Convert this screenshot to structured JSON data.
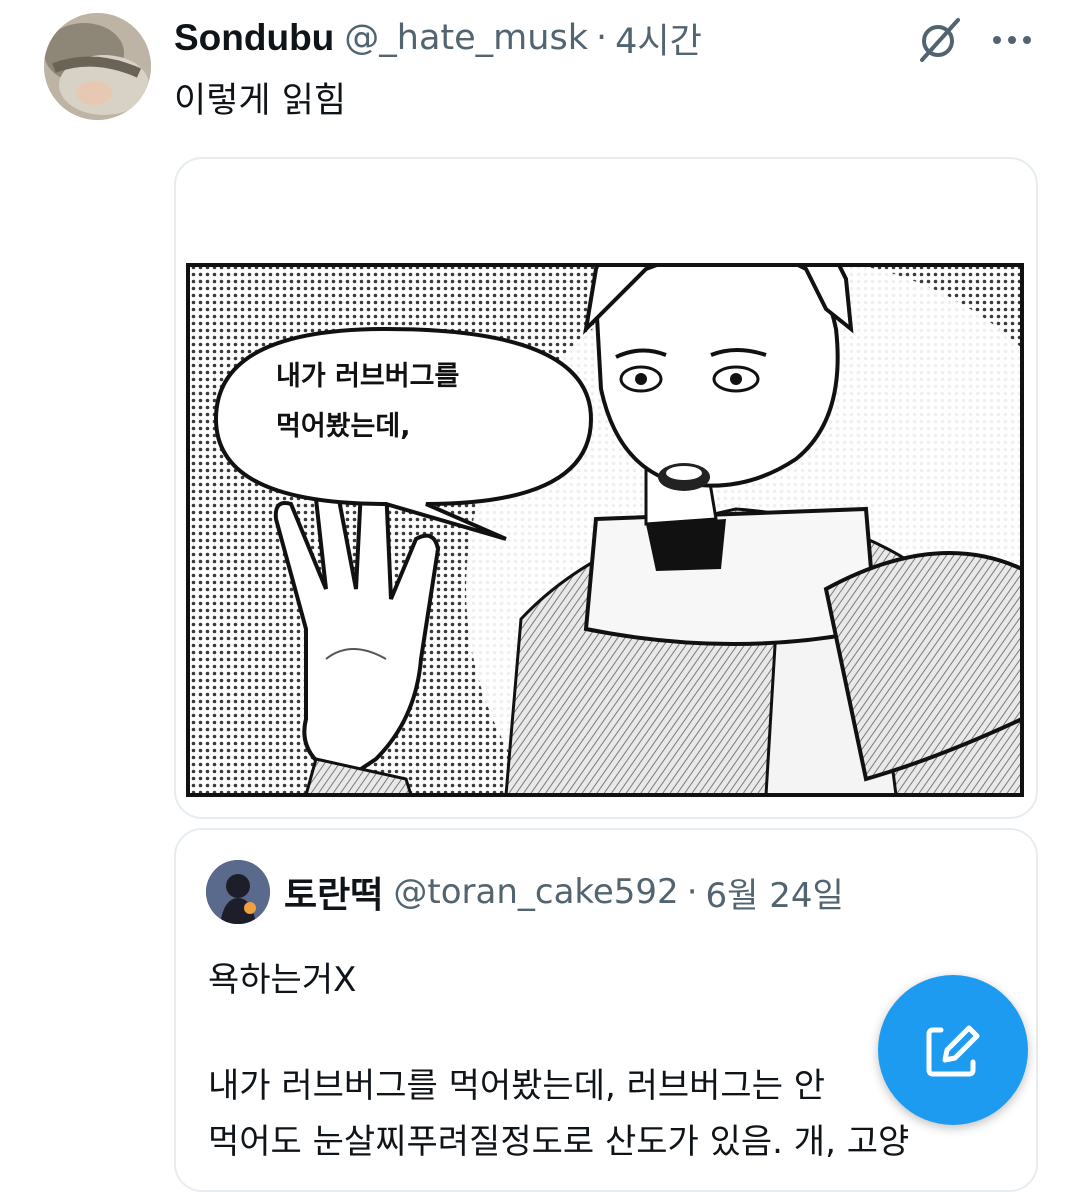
{
  "tweet": {
    "display_name": "Sondubu",
    "handle": "@_hate_musk",
    "separator": "·",
    "time": "4시간",
    "text": "이렇게 읽힘"
  },
  "media": {
    "speech_line1": "내가 러브버그를",
    "speech_line2": "먹어봤는데,"
  },
  "quote": {
    "display_name": "토란떡",
    "handle": "@toran_cake592",
    "separator": "·",
    "date": "6월 24일",
    "line1": "욕하는거X",
    "line2": "내가 러브버그를 먹어봤는데, 러브버그는 안",
    "line3": "먹어도 눈살찌푸려질정도로 산도가 있음. 개, 고양"
  },
  "icons": {
    "grok": "grok-icon",
    "more": "more-icon",
    "compose": "compose-icon"
  },
  "colors": {
    "accent": "#1d9bf0",
    "secondary_text": "#536471",
    "border": "#e6ecf0"
  }
}
